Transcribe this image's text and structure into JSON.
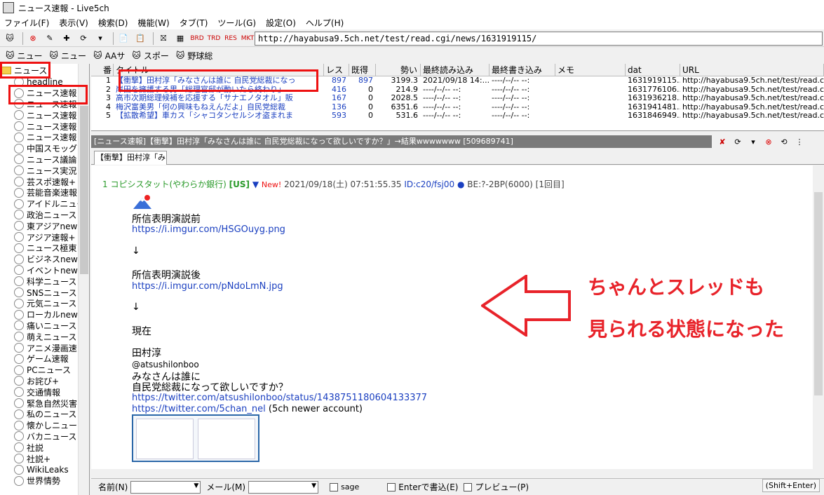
{
  "window": {
    "title": "ニュース速報 - Live5ch"
  },
  "menu": [
    "ファイル(F)",
    "表示(V)",
    "検索(D)",
    "機能(W)",
    "タブ(T)",
    "ツール(G)",
    "設定(O)",
    "ヘルプ(H)"
  ],
  "toolbar": {
    "url": "http://hayabusa9.5ch.net/test/read.cgi/news/1631919115/"
  },
  "links": [
    "ニュー",
    "ニュー",
    "AAサ",
    "スポー",
    "野球総"
  ],
  "sidebar": {
    "root_label": "ニュース",
    "items": [
      "headline",
      "ニュース速報",
      "ニュース速報",
      "ニュース速報",
      "ニュース速報",
      "ニュース速報",
      "中国スモッグ",
      "ニュース議論",
      "ニュース実況",
      "芸スポ速報+",
      "芸能音楽速報",
      "アイドルニュー",
      "政治ニュース",
      "東アジアnews",
      "アジア速報+",
      "ニュース極東",
      "ビジネスnews",
      "イベントnews",
      "科学ニュース",
      "SNSニュース",
      "元気ニュース",
      "ローカルnews",
      "痛いニュース",
      "萌えニュース",
      "アニメ漫画速",
      "ゲーム速報",
      "PCニュース",
      "お詫び+",
      "交通情報",
      "緊急自然災害",
      "私のニュース",
      "懐かしニュー",
      "バカニュース",
      "社説",
      "社説+",
      "WikiLeaks",
      "世界情勢"
    ]
  },
  "thread_list": {
    "headers": [
      "番",
      "タイトル",
      "レス",
      "既得",
      "勢い",
      "最終読み込み",
      "最終書き込み",
      "メモ",
      "dat",
      "URL"
    ],
    "rows": [
      {
        "no": "1",
        "title": "【衝撃】田村淳「みなさんは誰に 自民党総裁になっ",
        "res": "897",
        "got": "897",
        "ikioi": "3199.3",
        "last_read": "2021/09/18 14:...",
        "last_write": "----/--/-- --:",
        "memo": "",
        "dat": "1631919115...",
        "url": "http://hayabusa9.5ch.net/test/read.cgi"
      },
      {
        "no": "2",
        "title": "岸田を擁護する男「総理官邸が動いたら終わり」",
        "res": "416",
        "got": "0",
        "ikioi": "214.9",
        "last_read": "----/--/-- --:",
        "last_write": "----/--/-- --:",
        "memo": "",
        "dat": "1631776106...",
        "url": "http://hayabusa9.5ch.net/test/read.cgi"
      },
      {
        "no": "3",
        "title": "高市次期総理候補を応援する「サナエノタオル」販",
        "res": "167",
        "got": "0",
        "ikioi": "2028.5",
        "last_read": "----/--/-- --:",
        "last_write": "----/--/-- --:",
        "memo": "",
        "dat": "1631936218...",
        "url": "http://hayabusa9.5ch.net/test/read.cgi"
      },
      {
        "no": "4",
        "title": "梅沢富美男「何の興味もねえんだよ」自民党総裁",
        "res": "136",
        "got": "0",
        "ikioi": "6351.6",
        "last_read": "----/--/-- --:",
        "last_write": "----/--/-- --:",
        "memo": "",
        "dat": "1631941481...",
        "url": "http://hayabusa9.5ch.net/test/read.cgi"
      },
      {
        "no": "5",
        "title": "【拡散希望】車カス「シャコタンセルシオ盗まれま",
        "res": "593",
        "got": "0",
        "ikioi": "531.6",
        "last_read": "----/--/-- --:",
        "last_write": "----/--/-- --:",
        "memo": "",
        "dat": "1631846949...",
        "url": "http://hayabusa9.5ch.net/test/read.cgi"
      }
    ]
  },
  "thread": {
    "title_bar": "[ニュース速報]【衝撃】田村淳「みなさんは誰に 自民党総裁になって欲しいですか？」→結果wwwwwww [509689741]",
    "tab_label": "【衝撃】田村淳「みな"
  },
  "post": {
    "number": "1",
    "name": "コピシスタット(やわらか銀行)",
    "country": "[US]",
    "new_label": "New!",
    "datetime": "2021/09/18(土) 07:51:55.35",
    "id": "ID:c20/fsj00",
    "be": "BE:?-2BP(6000)",
    "count": "[1回目]",
    "lines": {
      "l1": "所信表明演説前",
      "l2": "https://i.imgur.com/HSGOuyg.png",
      "l3": "↓",
      "l4": "所信表明演説後",
      "l5": "https://i.imgur.com/pNdoLmN.jpg",
      "l6": "↓",
      "l7": "現在",
      "l8": "田村淳",
      "l9": "@atsushilonboo",
      "l10": "みなさんは誰に",
      "l11": "自民党総裁になって欲しいですか？",
      "l12": "https://twitter.com/atsushilonboo/status/1438751180604133377",
      "l13": "https://twitter.com/5chan_nel",
      "l13b": " (5ch newer account)"
    }
  },
  "annotation": {
    "line1": "ちゃんとスレッドも",
    "line2": "見られる状態になった",
    "color": "#e8232a"
  },
  "bottom": {
    "name_label": "名前(N)",
    "mail_label": "メール(M)",
    "sage_label": "sage",
    "enter_label": "Enterで書込(E)",
    "preview_label": "プレビュー(P)",
    "shift_enter": "(Shift+Enter)"
  }
}
